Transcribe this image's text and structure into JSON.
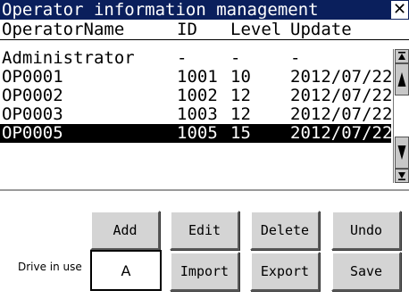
{
  "window": {
    "title": "Operator information management",
    "close_icon": "close-icon"
  },
  "columns": {
    "name": "OperatorName",
    "id": "ID",
    "level": "Level",
    "update": "Update"
  },
  "rows": [
    {
      "name": "Administrator",
      "id": "-",
      "level": "-",
      "update": "-",
      "selected": false
    },
    {
      "name": "OP0001",
      "id": "1001",
      "level": "10",
      "update": "2012/07/22",
      "selected": false
    },
    {
      "name": "OP0002",
      "id": "1002",
      "level": "12",
      "update": "2012/07/22",
      "selected": false
    },
    {
      "name": "OP0003",
      "id": "1003",
      "level": "12",
      "update": "2012/07/22",
      "selected": false
    },
    {
      "name": "OP0005",
      "id": "1005",
      "level": "15",
      "update": "2012/07/22",
      "selected": true
    }
  ],
  "scrollbar": {
    "icons": [
      "scroll-top-icon",
      "page-up-icon",
      "page-down-icon",
      "scroll-bottom-icon"
    ]
  },
  "buttons": {
    "add": "Add",
    "edit": "Edit",
    "delete": "Delete",
    "undo": "Undo",
    "import": "Import",
    "export": "Export",
    "save": "Save"
  },
  "drive": {
    "label": "Drive in use",
    "value": "A"
  },
  "colors": {
    "titlebar": "#0a1f5c",
    "selected_row": "#000000",
    "button_face": "#d4d4d4"
  }
}
